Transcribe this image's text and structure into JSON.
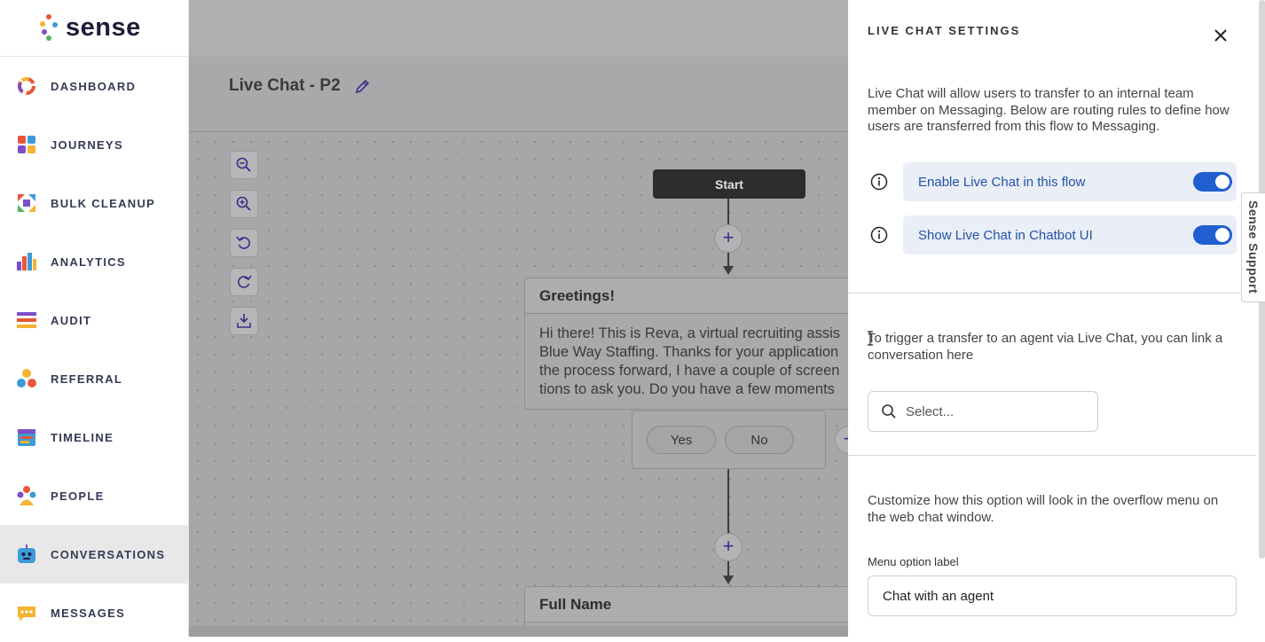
{
  "app": {
    "brand": "sense",
    "brand_colors": [
      "#e8583a",
      "#f4b331",
      "#3d9bd8",
      "#7c4fc8",
      "#54b36a"
    ]
  },
  "sidebar": {
    "items": [
      {
        "label": "DASHBOARD",
        "icon": "dashboard-ring-icon"
      },
      {
        "label": "JOURNEYS",
        "icon": "journeys-grid-icon"
      },
      {
        "label": "BULK CLEANUP",
        "icon": "bulk-cleanup-arrows-icon"
      },
      {
        "label": "ANALYTICS",
        "icon": "analytics-bars-icon"
      },
      {
        "label": "AUDIT",
        "icon": "audit-list-icon"
      },
      {
        "label": "REFERRAL",
        "icon": "referral-people-icon"
      },
      {
        "label": "TIMELINE",
        "icon": "timeline-calendar-icon"
      },
      {
        "label": "PEOPLE",
        "icon": "people-group-icon"
      },
      {
        "label": "CONVERSATIONS",
        "icon": "conversations-bot-icon",
        "active": true
      },
      {
        "label": "MESSAGES",
        "icon": "messages-bubble-icon"
      }
    ]
  },
  "flow": {
    "title": "Live Chat - P2",
    "start_label": "Start",
    "greeting_card": {
      "title": "Greetings!",
      "lines": [
        "Hi there! This is Reva, a virtual recruiting assis",
        "Blue Way Staffing. Thanks for your application",
        "the process forward, I have a couple of screen",
        "tions to ask you. Do you have a few moments"
      ]
    },
    "choices": [
      "Yes",
      "No"
    ],
    "next_card_title": "Full Name"
  },
  "panel": {
    "title": "LIVE CHAT SETTINGS",
    "intro": "Live Chat will allow users to transfer to an internal team member on Messaging. Below are routing rules to define how users are transferred from this flow to Messaging.",
    "toggles": [
      {
        "label": "Enable Live Chat in this flow",
        "on": true
      },
      {
        "label": "Show Live Chat in Chatbot UI",
        "on": true
      }
    ],
    "trigger_text": "To trigger a transfer to an agent via Live Chat, you can link a conversation here",
    "select_placeholder": "Select...",
    "customize_text": "Customize how this option will look in the overflow menu on the web chat window.",
    "menu_label": "Menu option label",
    "menu_value": "Chat with an agent",
    "accent": "#1f5fd0"
  },
  "support": {
    "label": "Sense Support"
  }
}
